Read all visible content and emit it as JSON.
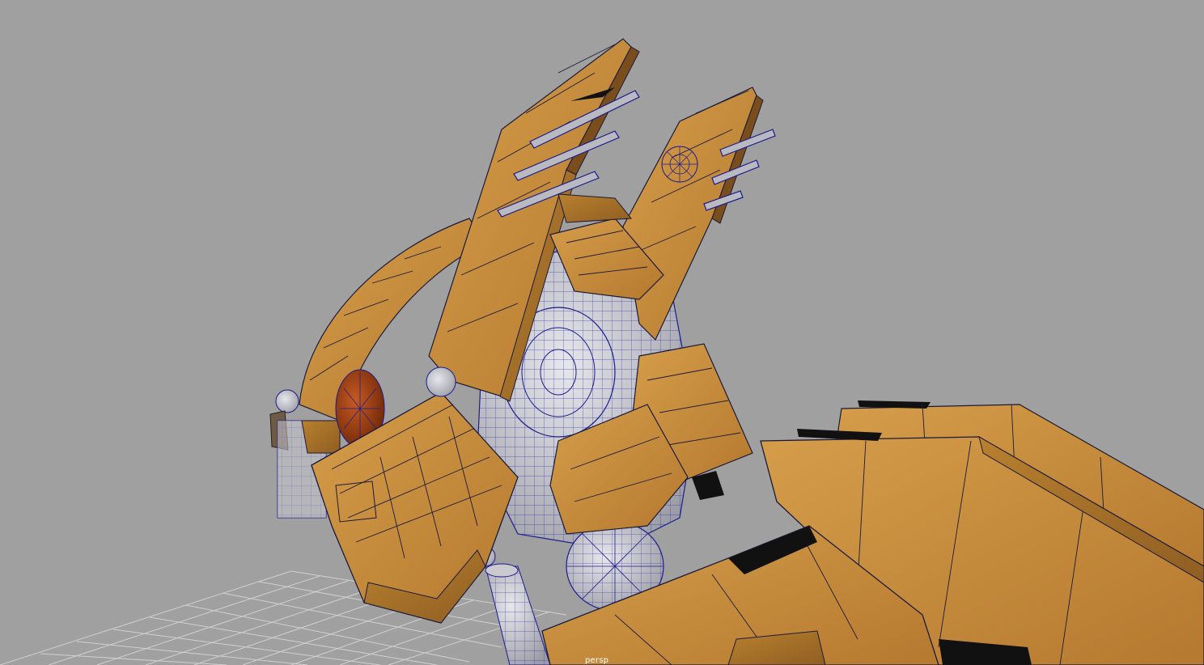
{
  "viewport": {
    "camera_name": "persp",
    "background_color": "#a0a0a0",
    "grid_color": "#d8d8d8",
    "mesh_color": "#c58e3f",
    "mesh_shadow_color": "#a56f2c",
    "wire_color": "#1c1c8c",
    "metal_color": "#c9c9cf",
    "eye_color": "#a8421a"
  }
}
